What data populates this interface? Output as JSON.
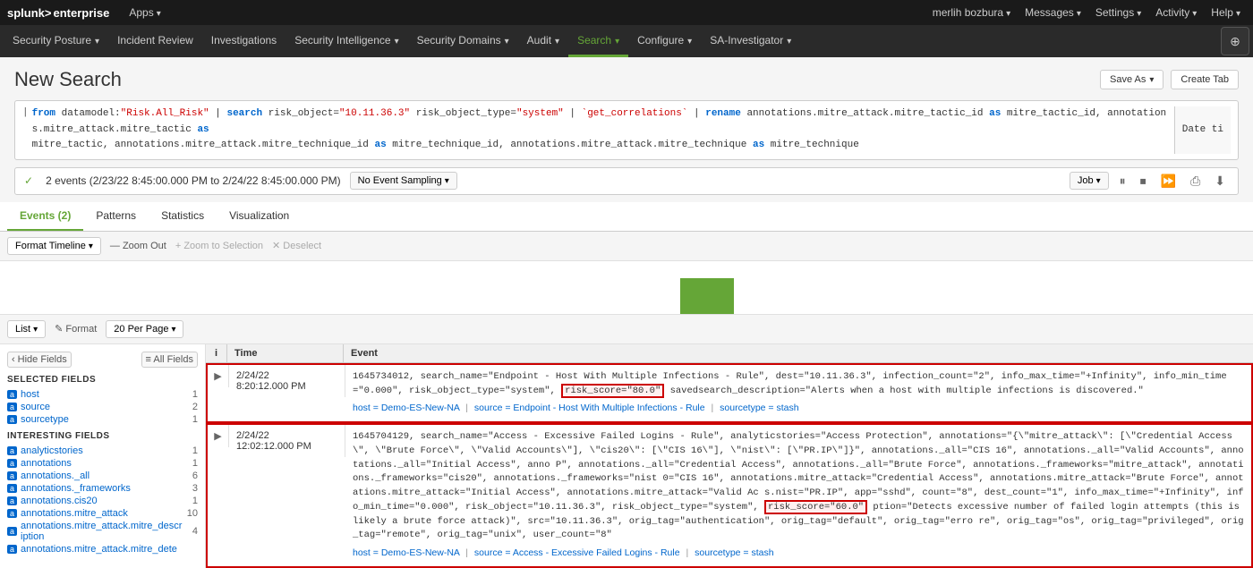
{
  "brand": {
    "logo_prefix": "splunk>",
    "logo_suffix": "enterprise"
  },
  "top_nav": {
    "left": [
      {
        "label": "Apps",
        "has_dropdown": true
      }
    ],
    "right": [
      {
        "label": "merlih bozbura",
        "has_dropdown": true
      },
      {
        "label": "Messages",
        "has_dropdown": true
      },
      {
        "label": "Settings",
        "has_dropdown": true
      },
      {
        "label": "Activity",
        "has_dropdown": true
      },
      {
        "label": "Help",
        "has_dropdown": true
      }
    ]
  },
  "nav_bar": {
    "items": [
      {
        "label": "Security Posture",
        "has_dropdown": true,
        "active": false
      },
      {
        "label": "Incident Review",
        "has_dropdown": false,
        "active": false
      },
      {
        "label": "Investigations",
        "has_dropdown": false,
        "active": false
      },
      {
        "label": "Security Intelligence",
        "has_dropdown": true,
        "active": false
      },
      {
        "label": "Security Domains",
        "has_dropdown": true,
        "active": false
      },
      {
        "label": "Audit",
        "has_dropdown": true,
        "active": false
      },
      {
        "label": "Search",
        "has_dropdown": true,
        "active": true
      },
      {
        "label": "Configure",
        "has_dropdown": true,
        "active": false
      },
      {
        "label": "SA-Investigator",
        "has_dropdown": true,
        "active": false
      }
    ],
    "globe_icon": "⊕"
  },
  "page": {
    "title": "New Search",
    "save_as_label": "Save As",
    "create_tab_label": "Create Tab"
  },
  "search_query": "| from datamodel:\"Risk.All_Risk\" | search risk_object=\"10.11.36.3\" risk_object_type=\"system\" | `get_correlations` | rename annotations.mitre_attack.mitre_tactic_id as mitre_tactic_id, annotations.mitre_attack.mitre_tactic as mitre_tactic, annotations.mitre_attack.mitre_technique_id as mitre_technique_id, annotations.mitre_attack.mitre_technique as mitre_technique",
  "search_date_btn": "Date ti",
  "stats_bar": {
    "check_icon": "✓",
    "events_text": "2 events (2/23/22 8:45:00.000 PM to 2/24/22 8:45:00.000 PM)",
    "sampling_label": "No Event Sampling",
    "job_label": "Job",
    "pause_icon": "⏸",
    "stop_icon": "⏹",
    "forward_icon": "⏩",
    "print_icon": "⎙",
    "download_icon": "⬇"
  },
  "tabs": [
    {
      "label": "Events (2)",
      "active": true
    },
    {
      "label": "Patterns",
      "active": false
    },
    {
      "label": "Statistics",
      "active": false
    },
    {
      "label": "Visualization",
      "active": false
    }
  ],
  "timeline": {
    "format_btn": "Format Timeline",
    "zoom_out_btn": "— Zoom Out",
    "zoom_selection_btn": "+ Zoom to Selection",
    "deselect_btn": "✕ Deselect"
  },
  "results_toolbar": {
    "list_btn": "List",
    "format_btn": "✎ Format",
    "per_page_btn": "20 Per Page"
  },
  "sidebar": {
    "hide_fields_btn": "Hide Fields",
    "all_fields_btn": "≡ All Fields",
    "selected_section": "SELECTED FIELDS",
    "selected_fields": [
      {
        "label": "host",
        "badge": "a",
        "count": "1"
      },
      {
        "label": "source",
        "badge": "a",
        "count": "2"
      },
      {
        "label": "sourcetype",
        "badge": "a",
        "count": "1"
      }
    ],
    "interesting_section": "INTERESTING FIELDS",
    "interesting_fields": [
      {
        "label": "analyticstories",
        "badge": "a",
        "count": "1"
      },
      {
        "label": "annotations",
        "badge": "a",
        "count": "1"
      },
      {
        "label": "annotations._all",
        "badge": "a",
        "count": "6"
      },
      {
        "label": "annotations._frameworks",
        "badge": "a",
        "count": "3"
      },
      {
        "label": "annotations.cis20",
        "badge": "a",
        "count": "1"
      },
      {
        "label": "annotations.mitre_attack",
        "badge": "a",
        "count": "10"
      },
      {
        "label": "annotations.mitre_attack.mitre_descr iption",
        "badge": "a",
        "count": "4"
      },
      {
        "label": "annotations.mitre_attack.mitre_dete",
        "badge": "a",
        "count": ""
      }
    ]
  },
  "events": [
    {
      "time_date": "2/24/22",
      "time_clock": "8:20:12.000 PM",
      "event_text": "1645734012, search_name=\"Endpoint - Host With Multiple Infections - Rule\", dest=\"10.11.36.3\", infection_count=\"2\", info_max_time=\"+Infinity\", info_min_time=\"0.000\", risk_object_type=\"system\",",
      "highlight": "risk_score=\"80.0\"",
      "event_text2": "savedsearch_description=\"Alerts when a host with multiple infections is discovered.\"",
      "meta_host": "Demo-ES-New-NA",
      "meta_source": "Endpoint - Host With Multiple Infections - Rule",
      "meta_sourcetype": "stash"
    },
    {
      "time_date": "2/24/22",
      "time_clock": "12:02:12.000 PM",
      "event_text": "1645704129, search_name=\"Access - Excessive Failed Logins - Rule\", analyticstories=\"Access Protection\", annotations=\"{\\\"mitre_attack\\\": [\\\"Credential Access\\\", \\\"Brute Force\\\", \\\"Valid Accounts\\\"], \\\"cis20\\\": [\\\"CIS 16\\\"], \\\"nist\\\": [\\\"PR.IP\\\"]}\" annotations._all=\"CIS 16\", annotations._all=\"Valid Accounts\", annotations._all=\"Initial Access\", annotations._all=\"Credential Access\", annotations._all=\"Brute Force\", annotations._frameworks=\"mitre_attack\", annotations._frameworks=\"cis20\", annotations._frameworks=\"nist\", annotations.cis20=\"CIS 16\", annotations.mitre_attack=\"Credential Access\", annotations.mitre_attack=\"Brute Force\", annotations.mitre_attack=\"Initial Access\", annotations.mitre_attack=\"Valid Ac s.nist=\"PR.IP\", app=\"sshd\", count=\"8\", dest_count=\"1\", info_max_time=\"+Infinity\", info_min_time=\"0.000\", risk_object=\"10.11.36.3\", risk_object_type=\"system\",",
      "highlight": "risk_score=\"60.0\"",
      "event_text2": "ption=\"Detects excessive number of failed login attempts (this is likely a brute force attack)\", src=\"10.11.36.3\", orig_tag=\"authentication\", orig_tag=\"default\", orig_tag=\"erro re\", orig_tag=\"os\", orig_tag=\"privileged\", orig_tag=\"remote\", orig_tag=\"unix\", user_count=\"8\"",
      "meta_host": "Demo-ES-New-NA",
      "meta_source": "Access - Excessive Failed Logins - Rule",
      "meta_sourcetype": "stash"
    }
  ]
}
